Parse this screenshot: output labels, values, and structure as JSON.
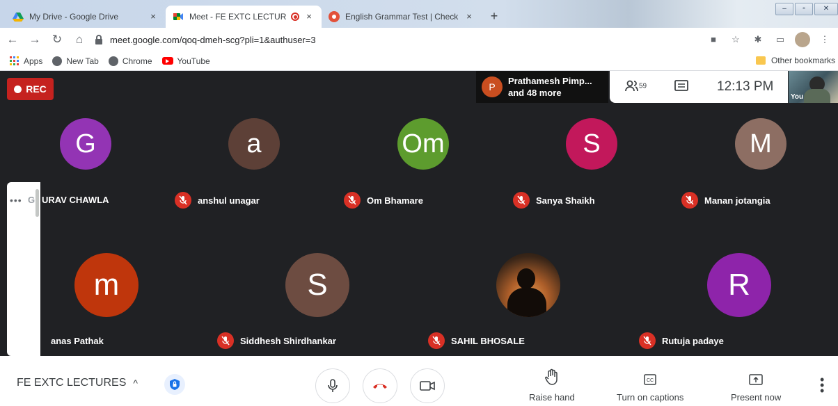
{
  "browser": {
    "tabs": [
      {
        "title": "My Drive - Google Drive",
        "close": "×"
      },
      {
        "title": "Meet - FE EXTC LECTURES",
        "close": "×"
      },
      {
        "title": "English Grammar Test | Check yo",
        "close": "×"
      }
    ],
    "new_tab": "+",
    "url": "meet.google.com/qoq-dmeh-scg?pli=1&authuser=3",
    "bookmarks": [
      {
        "label": "Apps"
      },
      {
        "label": "New Tab"
      },
      {
        "label": "Chrome"
      },
      {
        "label": "YouTube"
      }
    ],
    "other_bookmarks": "Other bookmarks"
  },
  "meet": {
    "rec_label": "REC",
    "notification": {
      "avatar_letter": "P",
      "line1": "Prathamesh Pimp...",
      "line2": "and 48 more"
    },
    "people_count": "59",
    "time": "12:13 PM",
    "self_label": "You",
    "sidepanel_dots": "•••",
    "participants": [
      {
        "name": "GAURAV CHAWLA",
        "shown_name": "URAV CHAWLA",
        "initial": "G",
        "color": "#9334b4",
        "obscured_prefix": "G"
      },
      {
        "name": "anshul unagar",
        "initial": "a",
        "color": "#5d4037"
      },
      {
        "name": "Om Bhamare",
        "initial": "Om",
        "color": "#5d9c2e"
      },
      {
        "name": "Sanya Shaikh",
        "initial": "S",
        "color": "#c2185b"
      },
      {
        "name": "Manan jotangia",
        "initial": "M",
        "color": "#8d6e63"
      },
      {
        "name": "manas Pathak",
        "shown_name": "anas Pathak",
        "initial": "m",
        "color": "#bf360c"
      },
      {
        "name": "Siddhesh Shirdhankar",
        "initial": "S",
        "color": "#6d4c41"
      },
      {
        "name": "SAHIL BHOSALE",
        "initial": "",
        "color": "#3a2a1a"
      },
      {
        "name": "Rutuja padaye",
        "initial": "R",
        "color": "#8e24aa"
      }
    ]
  },
  "bottom": {
    "meeting_name": "FE EXTC LECTURES",
    "chevron": "^",
    "raise_hand": "Raise hand",
    "captions": "Turn on captions",
    "present": "Present now"
  }
}
